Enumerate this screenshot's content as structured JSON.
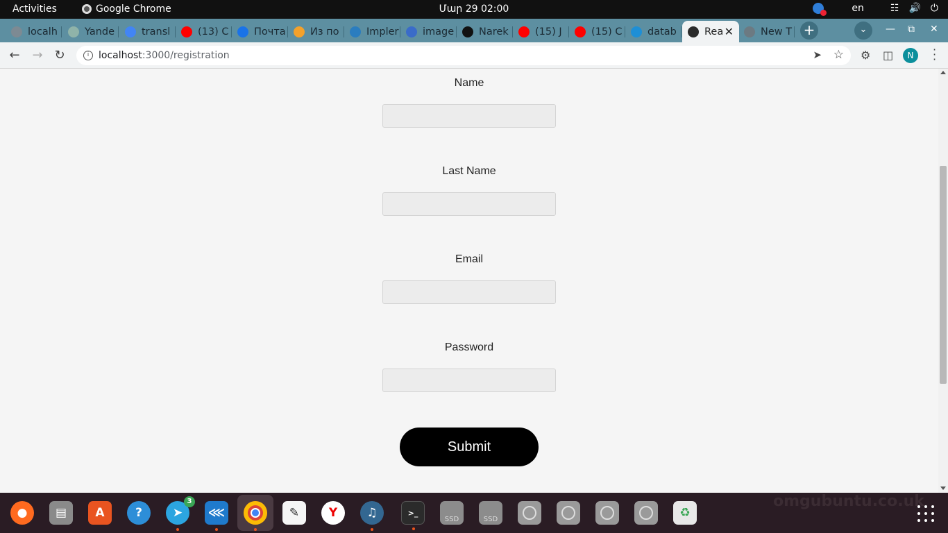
{
  "topbar": {
    "activities": "Activities",
    "app_name": "Google Chrome",
    "clock": "Մար 29  02:00",
    "lang": "en"
  },
  "tabs": [
    {
      "title": "localh",
      "color": "#7d8a93"
    },
    {
      "title": "Yande",
      "color": "#8fb3a9"
    },
    {
      "title": "transl",
      "color": "#4285f4"
    },
    {
      "title": "(13) C",
      "color": "#ff0000"
    },
    {
      "title": "Почта",
      "color": "#1a73e8"
    },
    {
      "title": "Из по",
      "color": "#f4a12b"
    },
    {
      "title": "Impler",
      "color": "#2b7dbf"
    },
    {
      "title": "image",
      "color": "#3a6cc9"
    },
    {
      "title": "Narek",
      "color": "#111111"
    },
    {
      "title": "(15) J",
      "color": "#ff0000"
    },
    {
      "title": "(15) C",
      "color": "#ff0000"
    },
    {
      "title": "datab",
      "color": "#1e8fd6"
    },
    {
      "title": "Rea",
      "color": "#2b2b2b",
      "active": true
    },
    {
      "title": "New T",
      "color": "#6c7a82"
    }
  ],
  "toolbar": {
    "url_host": "localhost",
    "url_path": ":3000/registration",
    "profile_initial": "N"
  },
  "form": {
    "fields": [
      {
        "label": "Name",
        "value": ""
      },
      {
        "label": "Last Name",
        "value": ""
      },
      {
        "label": "Email",
        "value": ""
      },
      {
        "label": "Password",
        "value": ""
      }
    ],
    "submit_label": "Submit"
  },
  "dock": {
    "telegram_badge": "3",
    "disk1_label": "SSD",
    "disk2_label": "SSD",
    "watermark": "omgubuntu.co.uk"
  }
}
